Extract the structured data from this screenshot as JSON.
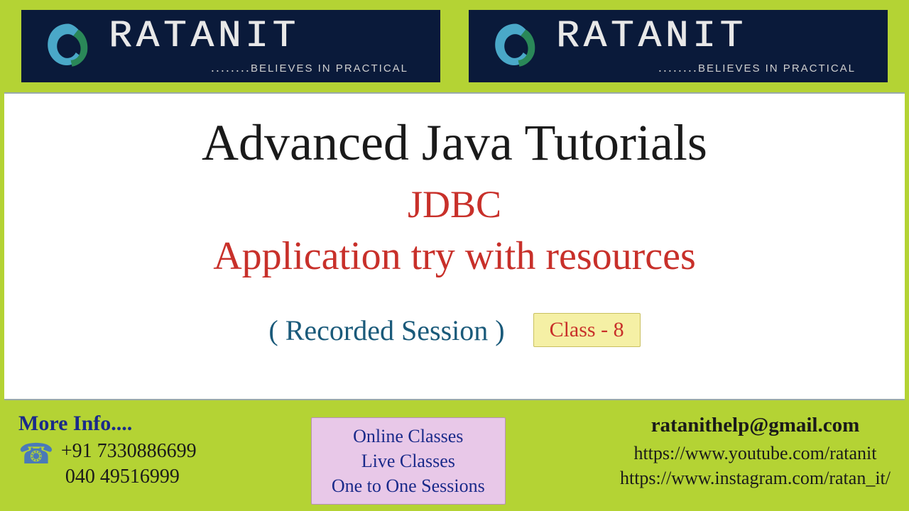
{
  "logo": {
    "name": "RATANIT",
    "tagline": "BELIEVES IN PRACTICAL",
    "dots": "........"
  },
  "main": {
    "title": "Advanced Java Tutorials",
    "subtitle1": "JDBC",
    "subtitle2": "Application try with resources",
    "recorded": "( Recorded Session )",
    "class_badge": "Class - 8"
  },
  "footer": {
    "more_info_label": "More Info....",
    "phone1": "+91 7330886699",
    "phone2": "040 49516999",
    "center": {
      "line1": "Online Classes",
      "line2": "Live Classes",
      "line3": "One to One Sessions"
    },
    "links": {
      "email": "ratanithelp@gmail.com",
      "youtube": "https://www.youtube.com/ratanit",
      "instagram": "https://www.instagram.com/ratan_it/"
    }
  }
}
